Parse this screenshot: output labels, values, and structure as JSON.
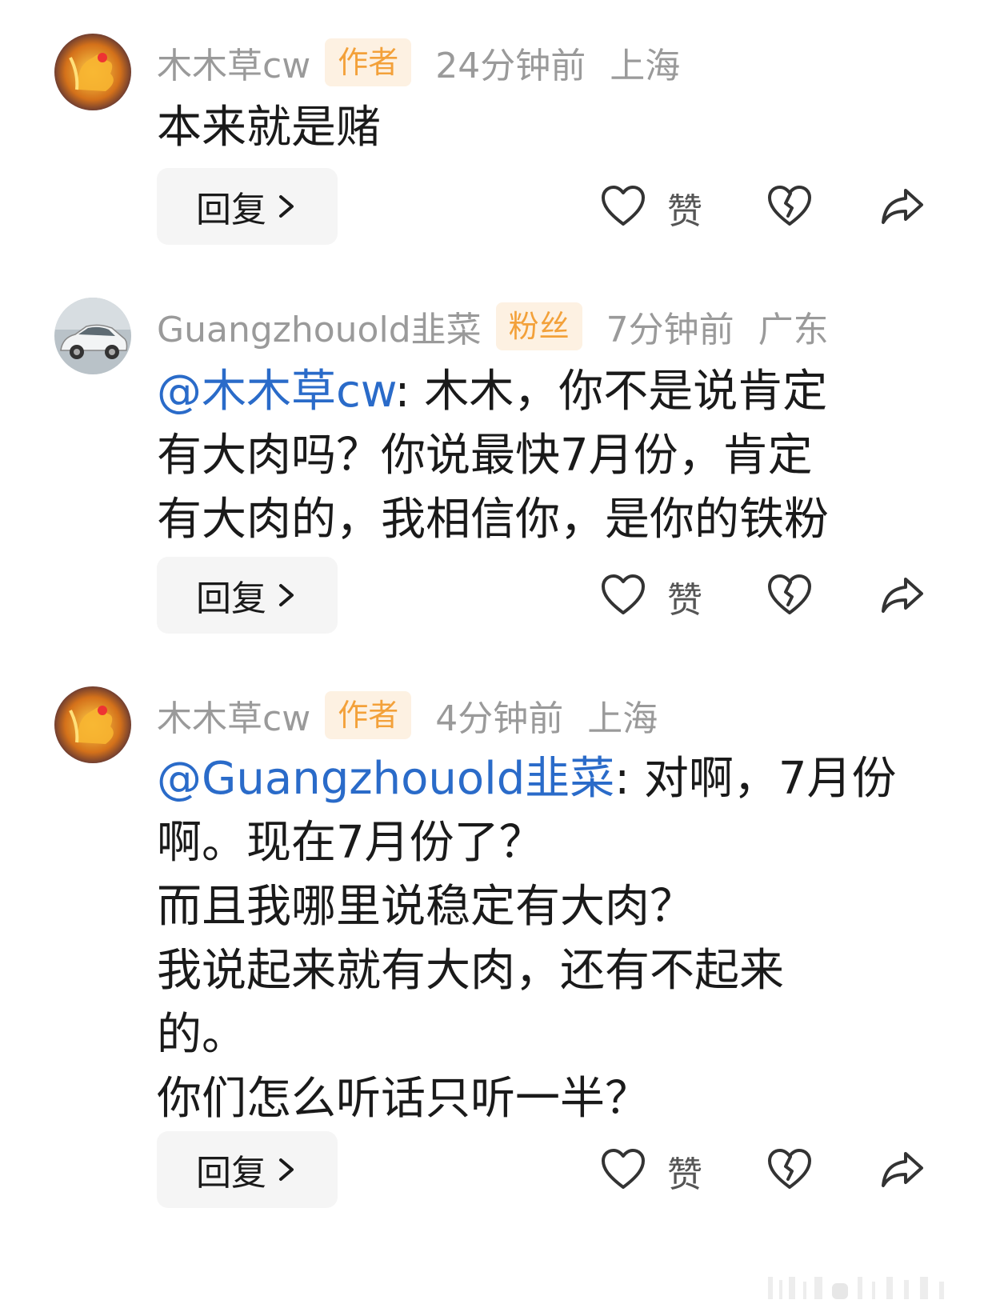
{
  "comments": [
    {
      "username": "木木草cw",
      "badge": "作者",
      "time": "24分钟前",
      "location": "上海",
      "mention": "",
      "text_lines": [
        "本来就是赌"
      ],
      "reply_label": "回复",
      "like_label": "赞"
    },
    {
      "username": "Guangzhouold韭菜",
      "badge": "粉丝",
      "time": "7分钟前",
      "location": "广东",
      "mention": "@木木草cw",
      "text_lines": [
        ": 木木，你不是说肯定",
        "有大肉吗？你说最快7月份，肯定",
        "有大肉的，我相信你，是你的铁粉"
      ],
      "reply_label": "回复",
      "like_label": "赞"
    },
    {
      "username": "木木草cw",
      "badge": "作者",
      "time": "4分钟前",
      "location": "上海",
      "mention": "@Guangzhouold韭菜",
      "text_lines": [
        ": 对啊，7月份",
        "啊。现在7月份了？",
        "而且我哪里说稳定有大肉？",
        "我说起来就有大肉，还有不起来",
        "的。",
        "你们怎么听话只听一半？"
      ],
      "reply_label": "回复",
      "like_label": "赞"
    }
  ],
  "icons": {
    "like": "heart-outline-icon",
    "dislike": "broken-heart-icon",
    "share": "share-arrow-icon",
    "reply_chevron": "chevron-right-icon"
  },
  "colors": {
    "mention": "#2a6bc9",
    "badge_text": "#f3a13a",
    "badge_bg": "#fdf1e2",
    "meta_gray": "#9a9a9a",
    "button_bg": "#f5f5f5"
  }
}
